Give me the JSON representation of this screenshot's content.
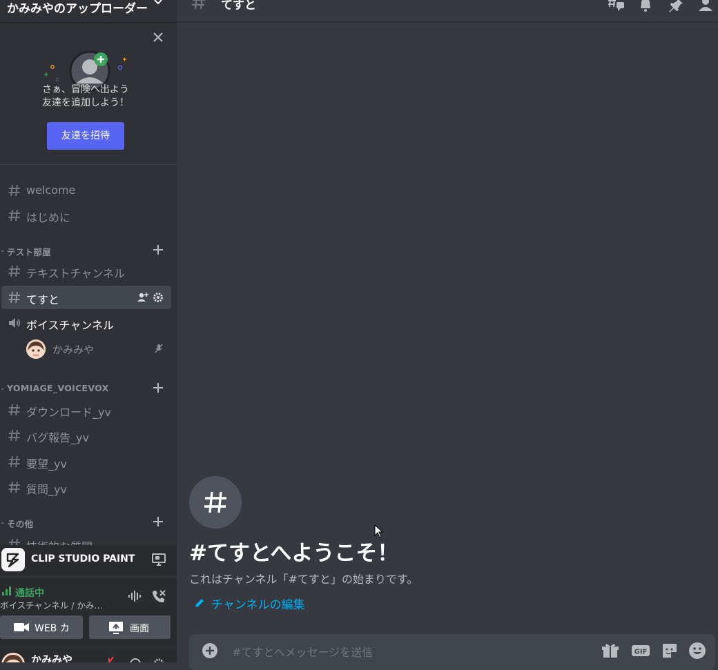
{
  "server": {
    "name": "かみみやのアップローダー"
  },
  "invite": {
    "line1": "さぁ、冒険へ出よう",
    "line2": "友達を追加しよう！",
    "button": "友達を招待"
  },
  "channels_top": [
    {
      "name": "welcome"
    },
    {
      "name": "はじめに"
    }
  ],
  "category_test": {
    "label": "テスト部屋",
    "channels": [
      {
        "name": "テキストチャンネル"
      },
      {
        "name": "てすと"
      }
    ],
    "voice": {
      "name": "ボイスチャンネル",
      "user": "かみみや"
    }
  },
  "category_yomiage": {
    "label": "YOMIAGE_VOICEVOX",
    "channels": [
      {
        "name": "ダウンロード_yv"
      },
      {
        "name": "バグ報告_yv"
      },
      {
        "name": "要望_yv"
      },
      {
        "name": "質問_yv"
      }
    ]
  },
  "category_other": {
    "label": "その他",
    "partial_channel": "技術的な質問"
  },
  "activity": {
    "app": "CLIP STUDIO PAINT"
  },
  "voice_panel": {
    "status": "通話中",
    "channel": "ボイスチャンネル / かみ…",
    "video_label": "WEB カ",
    "screen_label": "画面"
  },
  "user": {
    "name": "かみみや"
  },
  "main": {
    "channel_title": "てすと",
    "welcome_title": "#てすとへようこそ！",
    "welcome_sub": "これはチャンネル「#てすと」の始まりです。",
    "edit_link": "チャンネルの編集",
    "composer_placeholder": "#てすとへメッセージを送信"
  },
  "colors": {
    "sidebar_bg": "#2f3136",
    "main_bg": "#36393f",
    "accent": "#5865f2",
    "link": "#00aff4",
    "voice_green": "#3ba55d"
  }
}
